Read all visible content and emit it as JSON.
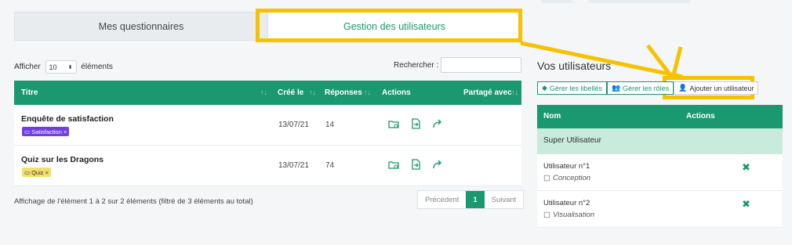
{
  "tabs": [
    {
      "label": "Mes questionnaires",
      "active": false
    },
    {
      "label": "Gestion des utilisateurs",
      "active": true
    }
  ],
  "controls": {
    "show_label": "Afficher",
    "page_size": "10",
    "entries_label": "éléments",
    "search_label": "Rechercher :",
    "search_value": ""
  },
  "table": {
    "columns": [
      "Titre",
      "Créé le",
      "Réponses",
      "Actions",
      "Partagé avec"
    ],
    "rows": [
      {
        "title": "Enquête de satisfaction",
        "tag": "Satisfaction ×",
        "tag_color": "#6f3fe0",
        "date": "13/07/21",
        "responses": "14"
      },
      {
        "title": "Quiz sur les Dragons",
        "tag": "Quiz ×",
        "tag_color": "#f2e06a",
        "date": "13/07/21",
        "responses": "74"
      }
    ]
  },
  "info": "Affichage de l'élément 1 à 2 sur 2 éléments (filtré de 3 éléments au total)",
  "pager": {
    "prev": "Précédent",
    "current": "1",
    "next": "Suivant"
  },
  "users_panel": {
    "title": "Vos utilisateurs",
    "buttons": [
      "Gérer les libellés",
      "Gérer les rôles",
      "Ajouter un utilisateur"
    ],
    "columns": [
      "Nom",
      "Actions"
    ],
    "group": "Super Utilisateur",
    "users": [
      {
        "name": "Utilisateur n°1",
        "role": "Conception"
      },
      {
        "name": "Utilisateur n°2",
        "role": "Visualisation"
      }
    ]
  },
  "colors": {
    "accent": "#1a9870",
    "highlight": "#f6c200"
  }
}
